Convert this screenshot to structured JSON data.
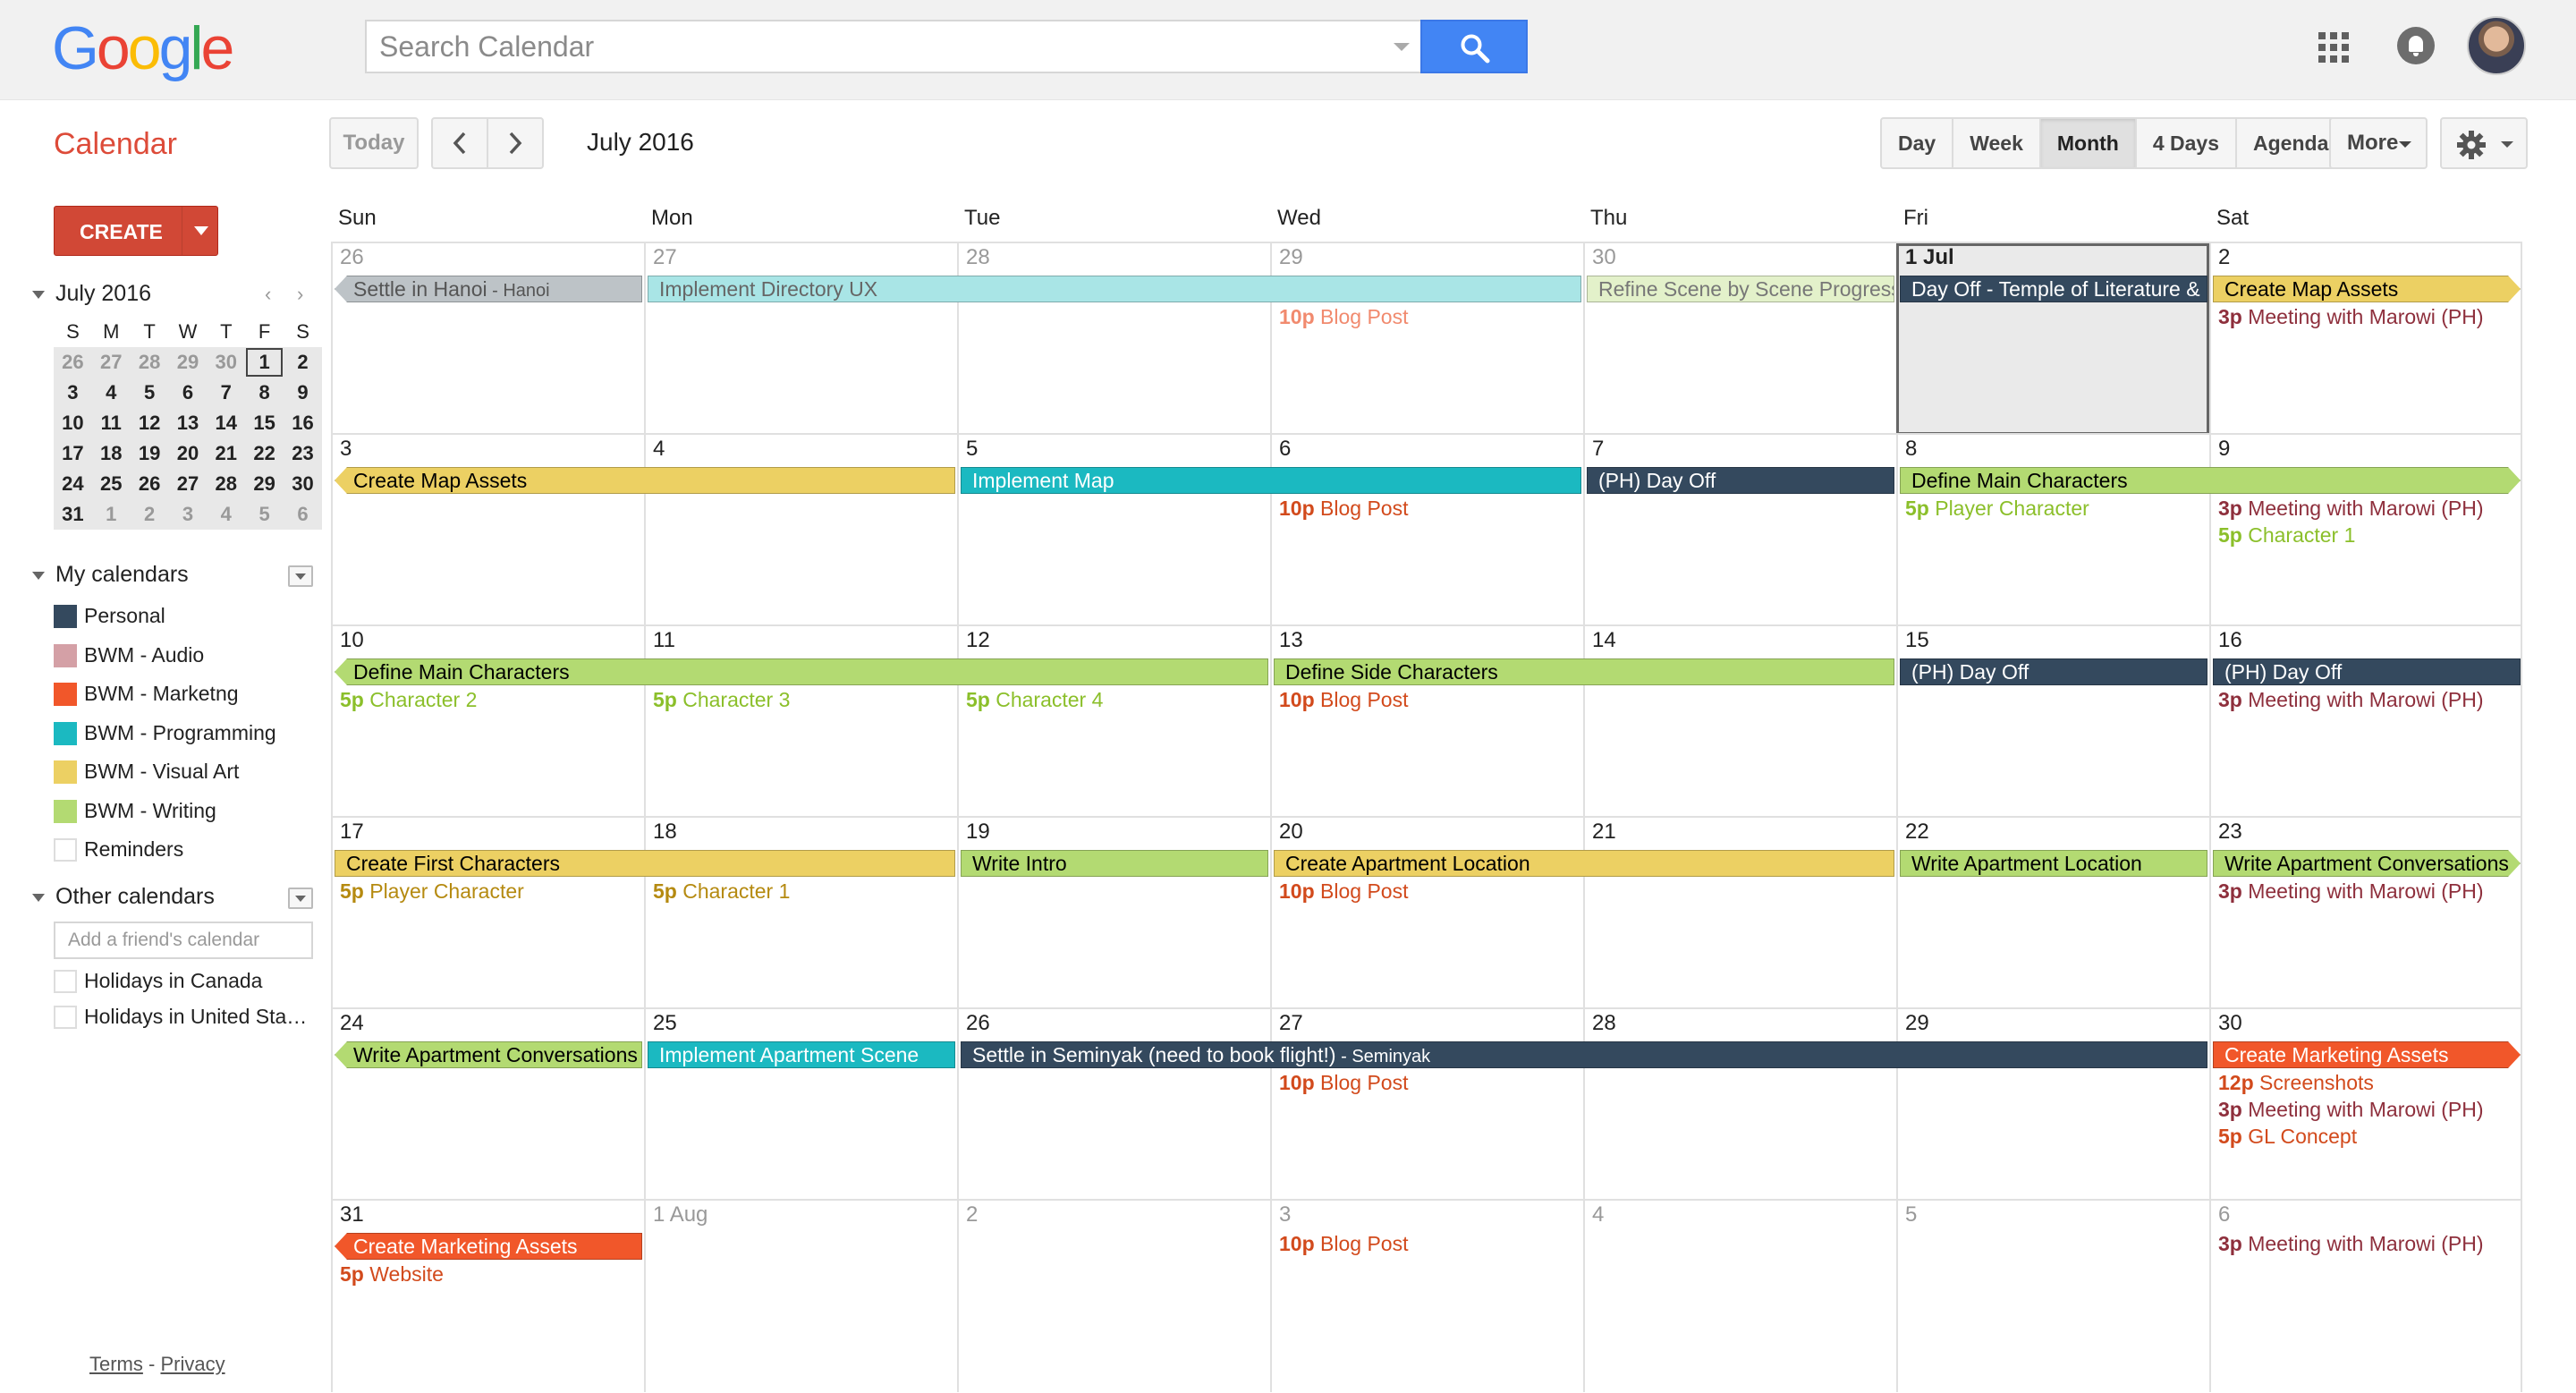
{
  "header": {
    "logo": "Google",
    "search_placeholder": "Search Calendar"
  },
  "toolbar": {
    "app_title": "Calendar",
    "today_label": "Today",
    "month_label": "July 2016",
    "views": [
      "Day",
      "Week",
      "Month",
      "4 Days",
      "Agenda"
    ],
    "active_view": "Month",
    "more_label": "More"
  },
  "sidebar": {
    "create_label": "CREATE",
    "mini_cal": {
      "title": "July 2016",
      "dow": [
        "S",
        "M",
        "T",
        "W",
        "T",
        "F",
        "S"
      ],
      "weeks": [
        [
          "26",
          "27",
          "28",
          "29",
          "30",
          "1",
          "2"
        ],
        [
          "3",
          "4",
          "5",
          "6",
          "7",
          "8",
          "9"
        ],
        [
          "10",
          "11",
          "12",
          "13",
          "14",
          "15",
          "16"
        ],
        [
          "17",
          "18",
          "19",
          "20",
          "21",
          "22",
          "23"
        ],
        [
          "24",
          "25",
          "26",
          "27",
          "28",
          "29",
          "30"
        ],
        [
          "31",
          "1",
          "2",
          "3",
          "4",
          "5",
          "6"
        ]
      ]
    },
    "my_calendars_label": "My calendars",
    "my_calendars": [
      {
        "name": "Personal",
        "color": "#34495e"
      },
      {
        "name": "BWM - Audio",
        "color": "#d4a0a6"
      },
      {
        "name": "BWM - Marketng",
        "color": "#f1572a"
      },
      {
        "name": "BWM - Programming",
        "color": "#1bb9c1"
      },
      {
        "name": "BWM - Visual Art",
        "color": "#ecd063"
      },
      {
        "name": "BWM - Writing",
        "color": "#b3da72"
      },
      {
        "name": "Reminders",
        "color": ""
      }
    ],
    "other_calendars_label": "Other calendars",
    "friend_placeholder": "Add a friend's calendar",
    "other_calendars": [
      {
        "name": "Holidays in Canada"
      },
      {
        "name": "Holidays in United Sta…"
      }
    ],
    "footer_terms": "Terms",
    "footer_sep": "-",
    "footer_privacy": "Privacy"
  },
  "month": {
    "dow": [
      "Sun",
      "Mon",
      "Tue",
      "Wed",
      "Thu",
      "Fri",
      "Sat"
    ],
    "weeks": [
      {
        "days": [
          "26",
          "27",
          "28",
          "29",
          "30",
          "1 Jul",
          "2"
        ],
        "muted": [
          0,
          1,
          2,
          3,
          4
        ],
        "bold": [
          5
        ],
        "today": 5,
        "bars": [
          {
            "start": 0,
            "span": 1,
            "text": "Settle in Hanoi",
            "sub": " - Hanoi",
            "color": "#bdc3c7",
            "fg": "#555",
            "shape": "arrow-l"
          },
          {
            "start": 1,
            "span": 3,
            "text": "Implement Directory UX",
            "sub": "",
            "color": "#a9e5e6",
            "fg": "#666",
            "shape": ""
          },
          {
            "start": 4,
            "span": 1,
            "text": "Refine Scene by Scene Progress",
            "sub": "",
            "color": "#e3f1ca",
            "fg": "#777",
            "shape": ""
          },
          {
            "start": 5,
            "span": 1,
            "text": "Day Off - Temple of Literature & Lake",
            "sub": "",
            "color": "#34495e",
            "fg": "#fff",
            "shape": ""
          },
          {
            "start": 6,
            "span": 1,
            "text": "Create Map Assets",
            "sub": "",
            "color": "#ecd063",
            "fg": "#000",
            "shape": "arrow-r"
          }
        ],
        "timed": [
          {
            "day": 3,
            "row": 0,
            "time": "10p",
            "text": "Blog Post",
            "color": "#f18a6e"
          },
          {
            "day": 6,
            "row": 0,
            "time": "3p",
            "text": "Meeting with Marowi (PH)",
            "color": "#8e2f3c"
          }
        ]
      },
      {
        "days": [
          "3",
          "4",
          "5",
          "6",
          "7",
          "8",
          "9"
        ],
        "muted": [],
        "bold": [],
        "today": -1,
        "bars": [
          {
            "start": 0,
            "span": 2,
            "text": "Create Map Assets",
            "sub": "",
            "color": "#ecd063",
            "fg": "#000",
            "shape": "arrow-l"
          },
          {
            "start": 2,
            "span": 2,
            "text": "Implement Map",
            "sub": "",
            "color": "#1bb9c1",
            "fg": "#fff",
            "shape": ""
          },
          {
            "start": 4,
            "span": 1,
            "text": "(PH) Day Off",
            "sub": "",
            "color": "#34495e",
            "fg": "#fff",
            "shape": ""
          },
          {
            "start": 5,
            "span": 2,
            "text": "Define Main Characters",
            "sub": "",
            "color": "#b3da72",
            "fg": "#000",
            "shape": "arrow-r"
          }
        ],
        "timed": [
          {
            "day": 3,
            "row": 0,
            "time": "10p",
            "text": "Blog Post",
            "color": "#d24a1c"
          },
          {
            "day": 5,
            "row": 0,
            "time": "5p",
            "text": "Player Character",
            "color": "#8bbf2a"
          },
          {
            "day": 6,
            "row": 0,
            "time": "3p",
            "text": "Meeting with Marowi (PH)",
            "color": "#8e2f3c"
          },
          {
            "day": 6,
            "row": 1,
            "time": "5p",
            "text": "Character 1",
            "color": "#8bbf2a"
          }
        ]
      },
      {
        "days": [
          "10",
          "11",
          "12",
          "13",
          "14",
          "15",
          "16"
        ],
        "muted": [],
        "bold": [],
        "today": -1,
        "bars": [
          {
            "start": 0,
            "span": 3,
            "text": "Define Main Characters",
            "sub": "",
            "color": "#b3da72",
            "fg": "#000",
            "shape": "arrow-l"
          },
          {
            "start": 3,
            "span": 2,
            "text": "Define Side Characters",
            "sub": "",
            "color": "#b3da72",
            "fg": "#000",
            "shape": ""
          },
          {
            "start": 5,
            "span": 1,
            "text": "(PH) Day Off",
            "sub": "",
            "color": "#34495e",
            "fg": "#fff",
            "shape": ""
          },
          {
            "start": 6,
            "span": 1,
            "text": "(PH) Day Off",
            "sub": "",
            "color": "#34495e",
            "fg": "#fff",
            "shape": ""
          }
        ],
        "timed": [
          {
            "day": 0,
            "row": 0,
            "time": "5p",
            "text": "Character 2",
            "color": "#8bbf2a"
          },
          {
            "day": 1,
            "row": 0,
            "time": "5p",
            "text": "Character 3",
            "color": "#8bbf2a"
          },
          {
            "day": 2,
            "row": 0,
            "time": "5p",
            "text": "Character 4",
            "color": "#8bbf2a"
          },
          {
            "day": 3,
            "row": 0,
            "time": "10p",
            "text": "Blog Post",
            "color": "#d24a1c"
          },
          {
            "day": 6,
            "row": 0,
            "time": "3p",
            "text": "Meeting with Marowi (PH)",
            "color": "#8e2f3c"
          }
        ]
      },
      {
        "days": [
          "17",
          "18",
          "19",
          "20",
          "21",
          "22",
          "23"
        ],
        "muted": [],
        "bold": [],
        "today": -1,
        "bars": [
          {
            "start": 0,
            "span": 2,
            "text": "Create First Characters",
            "sub": "",
            "color": "#ecd063",
            "fg": "#000",
            "shape": ""
          },
          {
            "start": 2,
            "span": 1,
            "text": "Write Intro",
            "sub": "",
            "color": "#b3da72",
            "fg": "#000",
            "shape": ""
          },
          {
            "start": 3,
            "span": 2,
            "text": "Create Apartment Location",
            "sub": "",
            "color": "#ecd063",
            "fg": "#000",
            "shape": ""
          },
          {
            "start": 5,
            "span": 1,
            "text": "Write Apartment Location",
            "sub": "",
            "color": "#b3da72",
            "fg": "#000",
            "shape": ""
          },
          {
            "start": 6,
            "span": 1,
            "text": "Write Apartment Conversations",
            "sub": "",
            "color": "#b3da72",
            "fg": "#000",
            "shape": "arrow-r"
          }
        ],
        "timed": [
          {
            "day": 0,
            "row": 0,
            "time": "5p",
            "text": "Player Character",
            "color": "#b58a10"
          },
          {
            "day": 1,
            "row": 0,
            "time": "5p",
            "text": "Character 1",
            "color": "#b58a10"
          },
          {
            "day": 3,
            "row": 0,
            "time": "10p",
            "text": "Blog Post",
            "color": "#d24a1c"
          },
          {
            "day": 6,
            "row": 0,
            "time": "3p",
            "text": "Meeting with Marowi (PH)",
            "color": "#8e2f3c"
          }
        ]
      },
      {
        "days": [
          "24",
          "25",
          "26",
          "27",
          "28",
          "29",
          "30"
        ],
        "muted": [],
        "bold": [],
        "today": -1,
        "bars": [
          {
            "start": 0,
            "span": 1,
            "text": "Write Apartment Conversations",
            "sub": "",
            "color": "#b3da72",
            "fg": "#000",
            "shape": "arrow-l"
          },
          {
            "start": 1,
            "span": 1,
            "text": "Implement Apartment Scene",
            "sub": "",
            "color": "#1bb9c1",
            "fg": "#fff",
            "shape": ""
          },
          {
            "start": 2,
            "span": 4,
            "text": "Settle in Seminyak (need to book flight!)",
            "sub": " - Seminyak",
            "color": "#34495e",
            "fg": "#fff",
            "shape": ""
          },
          {
            "start": 6,
            "span": 1,
            "text": "Create Marketing Assets",
            "sub": "",
            "color": "#f1572a",
            "fg": "#fff",
            "shape": "arrow-r"
          }
        ],
        "timed": [
          {
            "day": 3,
            "row": 0,
            "time": "10p",
            "text": "Blog Post",
            "color": "#d24a1c"
          },
          {
            "day": 6,
            "row": 0,
            "time": "12p",
            "text": "Screenshots",
            "color": "#d24a1c"
          },
          {
            "day": 6,
            "row": 1,
            "time": "3p",
            "text": "Meeting with Marowi (PH)",
            "color": "#8e2f3c"
          },
          {
            "day": 6,
            "row": 2,
            "time": "5p",
            "text": "GL Concept",
            "color": "#d24a1c"
          }
        ]
      },
      {
        "days": [
          "31",
          "1 Aug",
          "2",
          "3",
          "4",
          "5",
          "6"
        ],
        "muted": [
          1,
          2,
          3,
          4,
          5,
          6
        ],
        "bold": [],
        "today": -1,
        "bars": [
          {
            "start": 0,
            "span": 1,
            "text": "Create Marketing Assets",
            "sub": "",
            "color": "#f1572a",
            "fg": "#fff",
            "shape": "arrow-l"
          }
        ],
        "timed": [
          {
            "day": 0,
            "row": 0,
            "time": "5p",
            "text": "Website",
            "color": "#d24a1c"
          },
          {
            "day": 3,
            "row": -1,
            "time": "10p",
            "text": "Blog Post",
            "color": "#d24a1c"
          },
          {
            "day": 6,
            "row": -1,
            "time": "3p",
            "text": "Meeting with Marowi (PH)",
            "color": "#8e2f3c"
          }
        ]
      }
    ]
  }
}
